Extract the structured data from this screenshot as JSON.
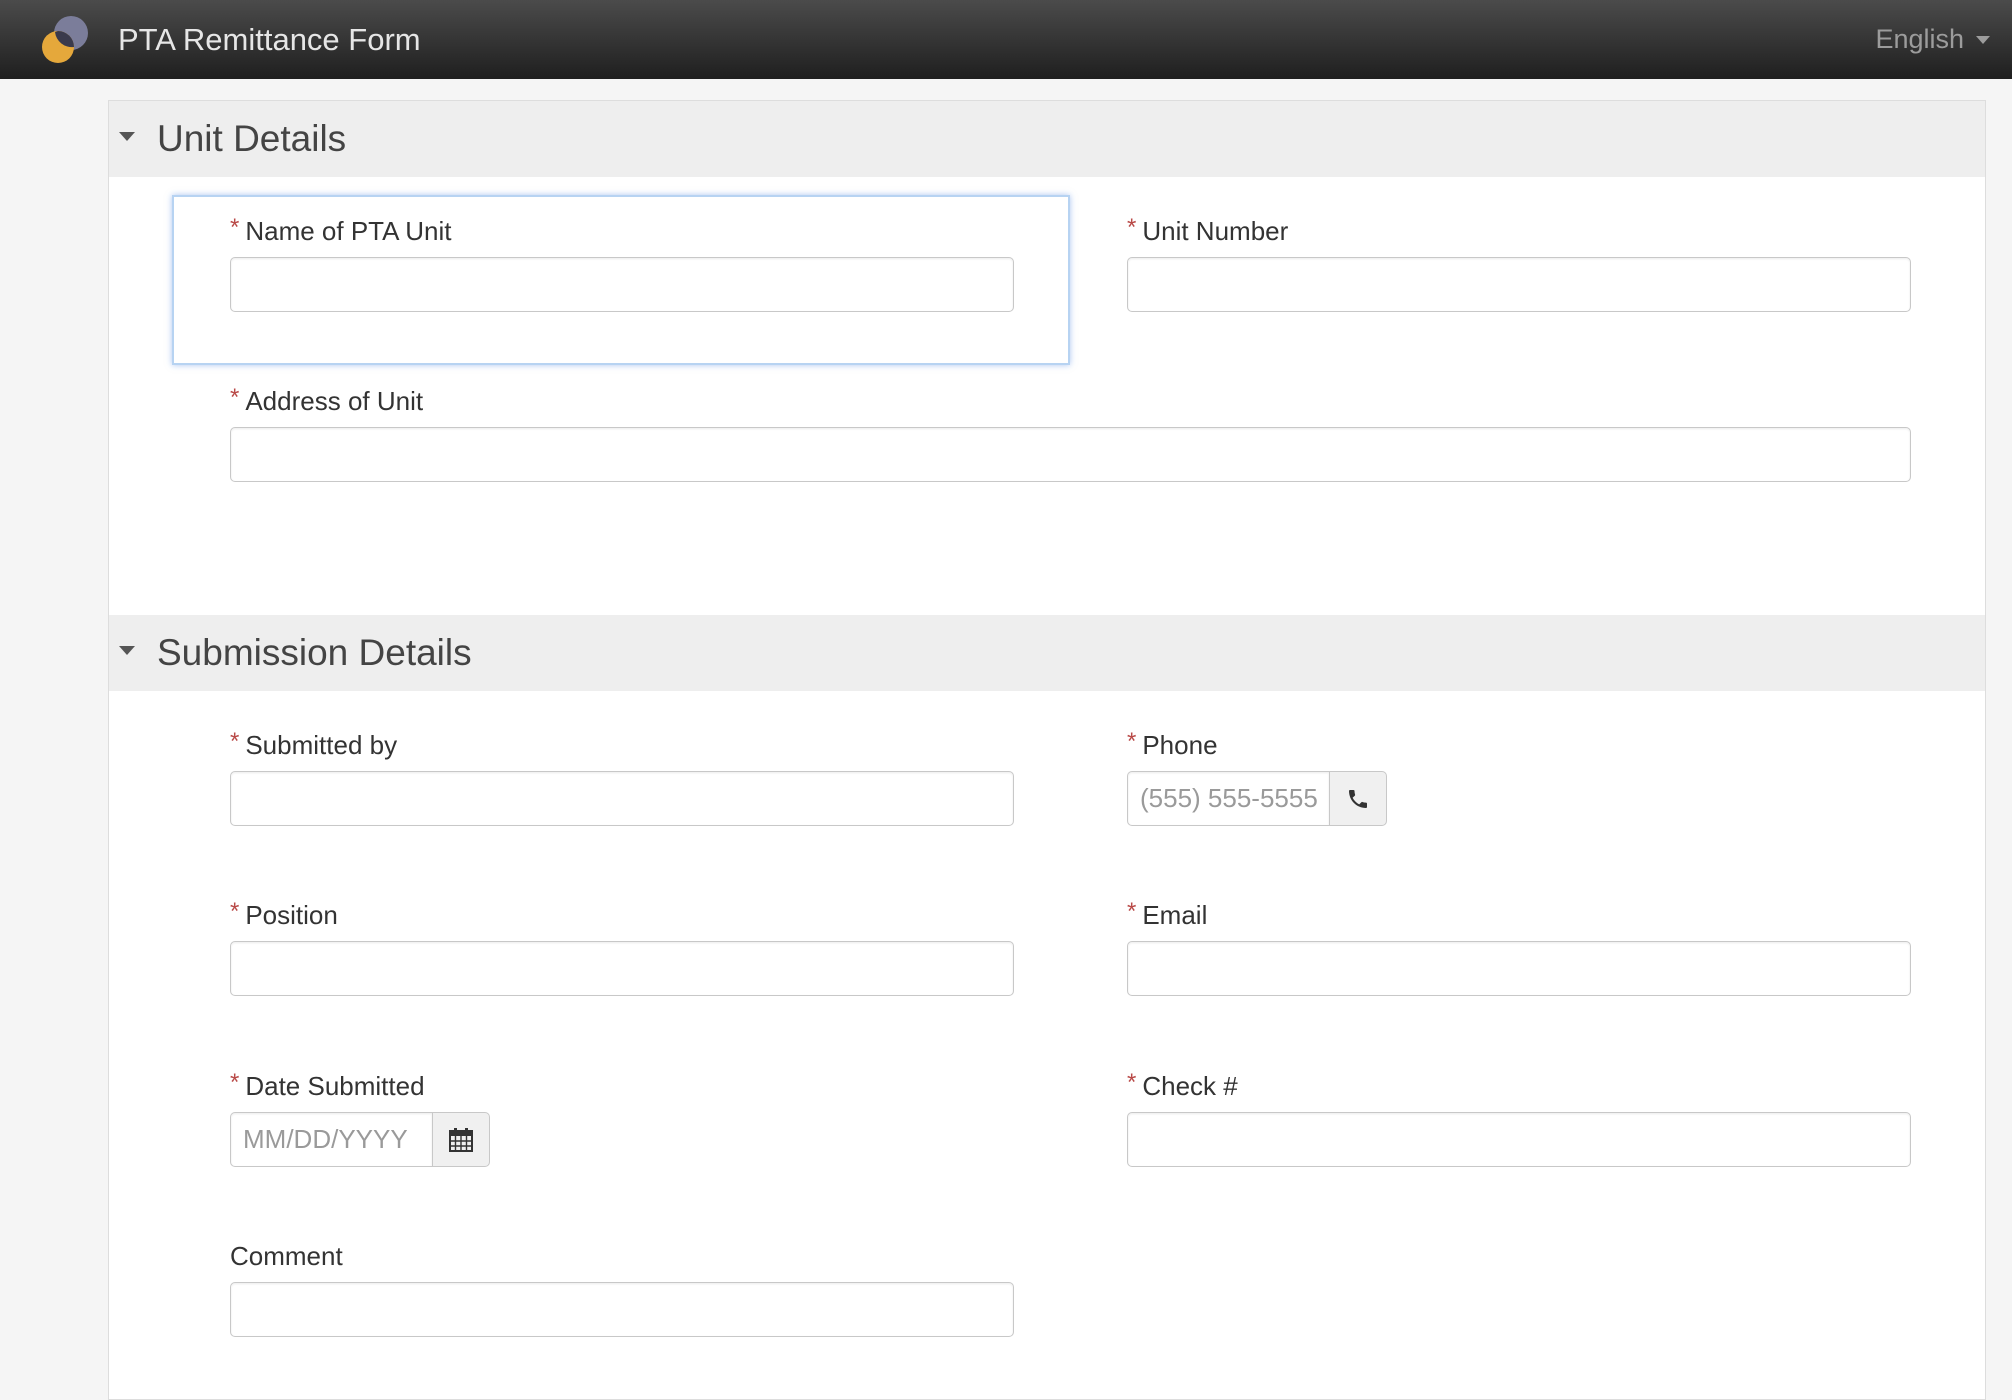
{
  "app": {
    "title": "PTA Remittance Form",
    "language": "English"
  },
  "sections": [
    {
      "title": "Unit Details",
      "fields": {
        "unit_name": {
          "label": "Name of PTA Unit",
          "required": true,
          "value": "",
          "placeholder": ""
        },
        "unit_number": {
          "label": "Unit Number",
          "required": true,
          "value": "",
          "placeholder": ""
        },
        "unit_address": {
          "label": "Address of Unit",
          "required": true,
          "value": "",
          "placeholder": ""
        }
      }
    },
    {
      "title": "Submission Details",
      "fields": {
        "submitted_by": {
          "label": "Submitted by",
          "required": true,
          "value": "",
          "placeholder": ""
        },
        "phone": {
          "label": "Phone",
          "required": true,
          "value": "",
          "placeholder": "(555) 555-5555"
        },
        "position": {
          "label": "Position",
          "required": true,
          "value": "",
          "placeholder": ""
        },
        "email": {
          "label": "Email",
          "required": true,
          "value": "",
          "placeholder": ""
        },
        "date_submitted": {
          "label": "Date Submitted",
          "required": true,
          "value": "",
          "placeholder": "MM/DD/YYYY"
        },
        "check_number": {
          "label": "Check #",
          "required": true,
          "value": "",
          "placeholder": ""
        },
        "comment": {
          "label": "Comment",
          "required": false,
          "value": "",
          "placeholder": ""
        }
      }
    }
  ],
  "required_marker": "*",
  "icons": {
    "phone": "phone-icon",
    "date": "calendar-icon",
    "section_toggle": "caret-down-icon",
    "language": "caret-down-icon"
  },
  "colors": {
    "required": "#b94a48",
    "focus": "#b7d3f2",
    "section_header_bg": "#eeeeee"
  }
}
